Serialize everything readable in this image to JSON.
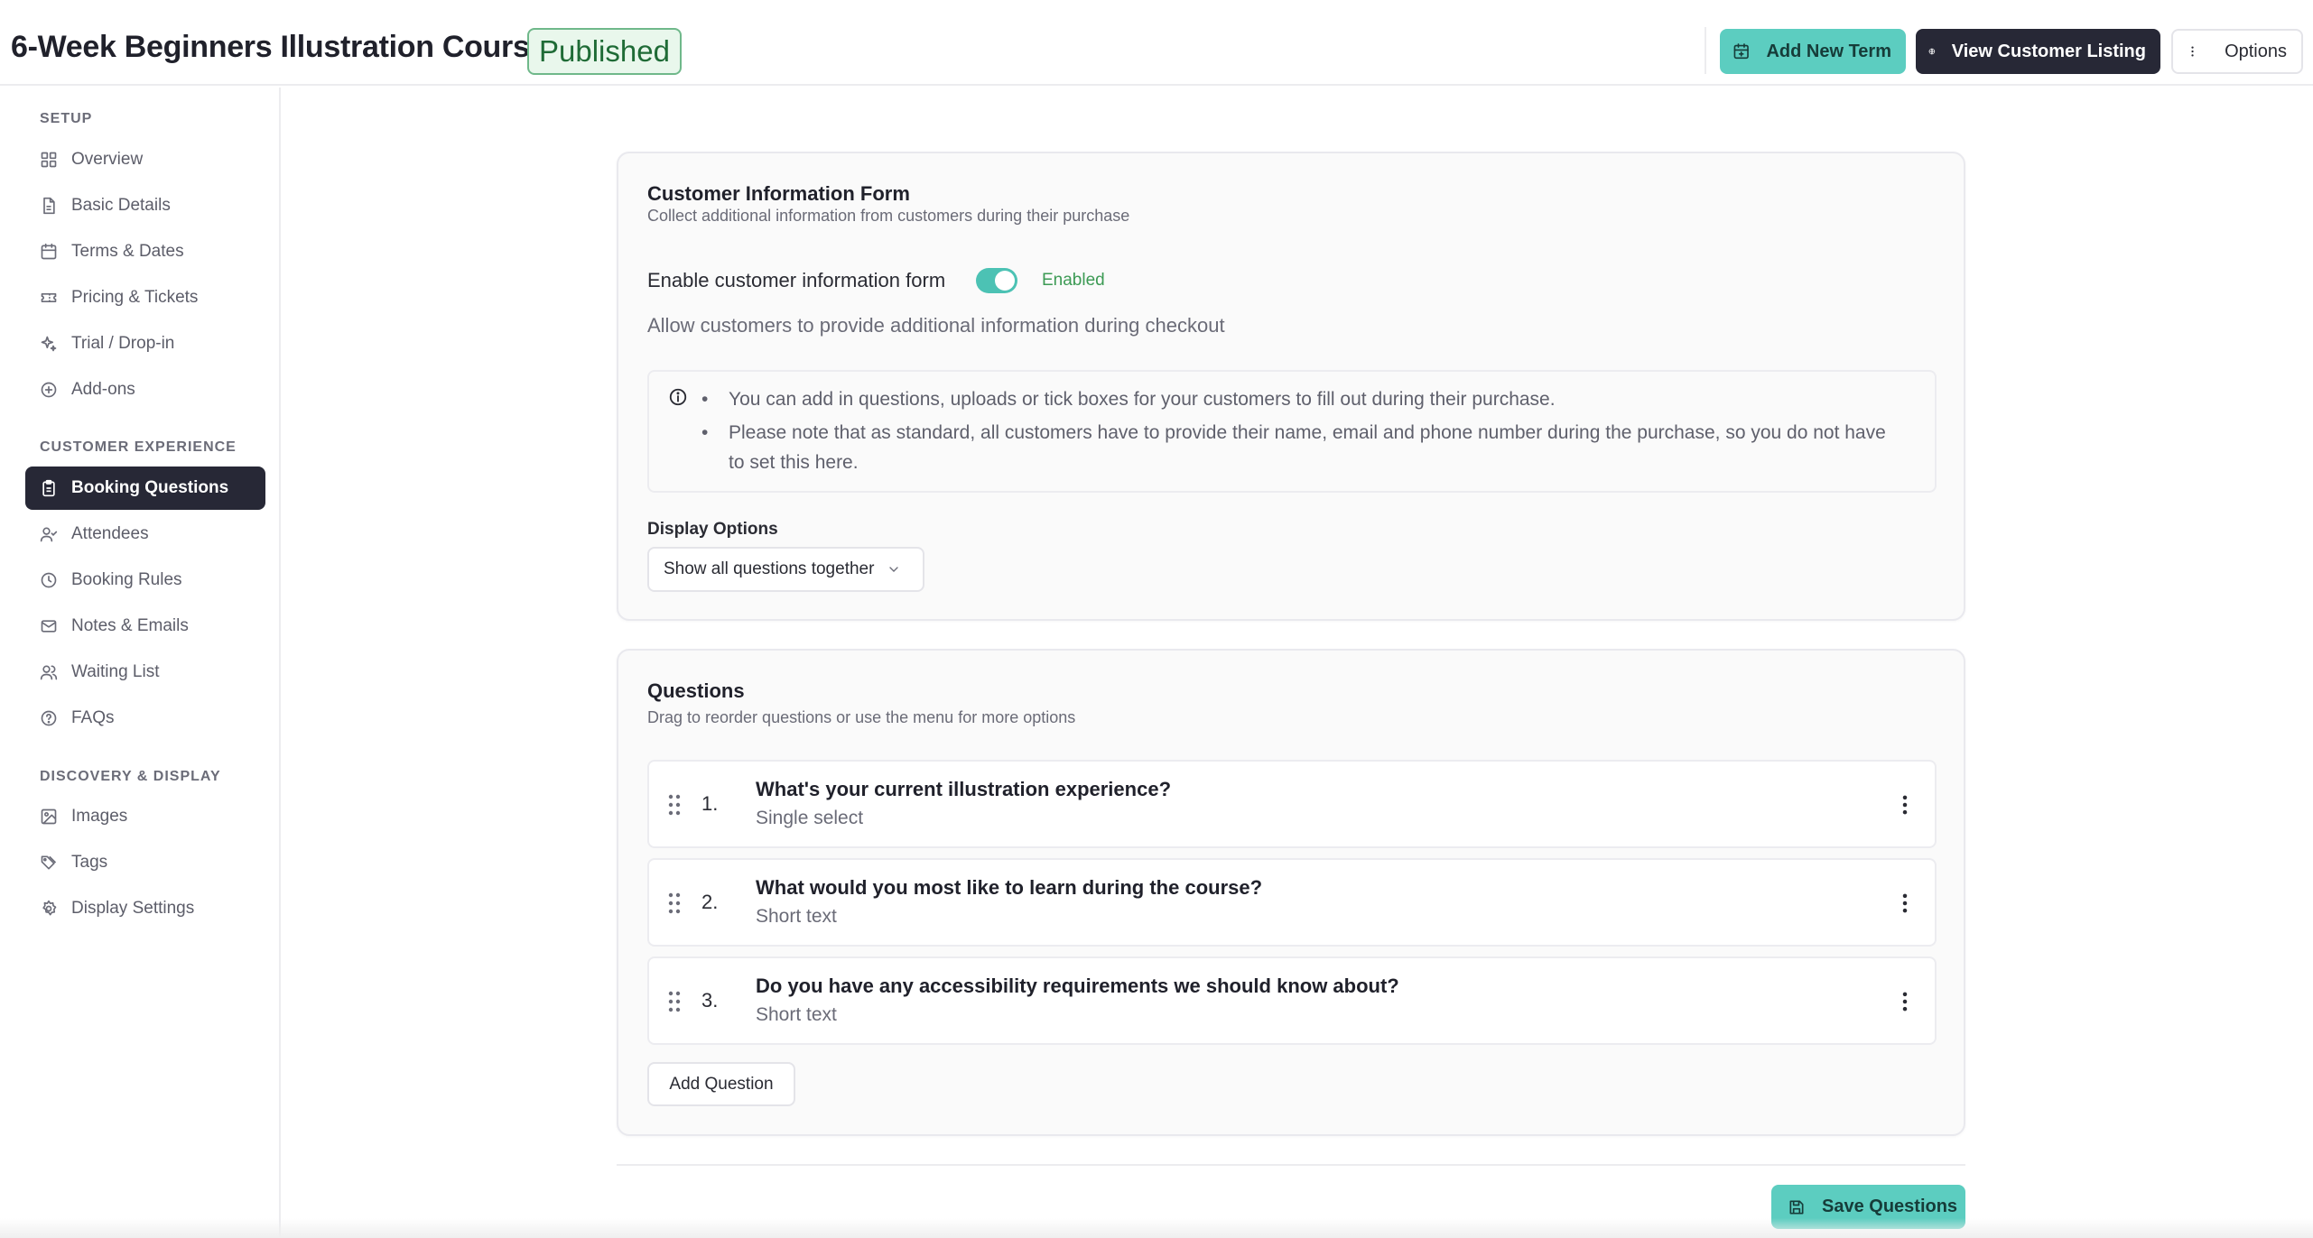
{
  "header": {
    "title": "6-Week Beginners Illustration Course",
    "status": "Published",
    "buttons": {
      "add_term": "Add New Term",
      "view_listing": "View Customer Listing",
      "options": "Options"
    }
  },
  "sidebar": {
    "sections": [
      {
        "title": "SETUP",
        "items": [
          {
            "label": "Overview",
            "icon": "grid-icon"
          },
          {
            "label": "Basic Details",
            "icon": "document-icon"
          },
          {
            "label": "Terms & Dates",
            "icon": "calendar-icon"
          },
          {
            "label": "Pricing & Tickets",
            "icon": "ticket-icon"
          },
          {
            "label": "Trial / Drop-in",
            "icon": "sparkle-icon"
          },
          {
            "label": "Add-ons",
            "icon": "plus-circle-icon"
          }
        ]
      },
      {
        "title": "CUSTOMER EXPERIENCE",
        "items": [
          {
            "label": "Booking Questions",
            "icon": "clipboard-icon",
            "active": true
          },
          {
            "label": "Attendees",
            "icon": "user-check-icon"
          },
          {
            "label": "Booking Rules",
            "icon": "clock-icon"
          },
          {
            "label": "Notes & Emails",
            "icon": "mail-icon"
          },
          {
            "label": "Waiting List",
            "icon": "users-icon"
          },
          {
            "label": "FAQs",
            "icon": "help-circle-icon"
          }
        ]
      },
      {
        "title": "DISCOVERY & DISPLAY",
        "items": [
          {
            "label": "Images",
            "icon": "image-icon"
          },
          {
            "label": "Tags",
            "icon": "tags-icon"
          },
          {
            "label": "Display Settings",
            "icon": "settings-icon"
          }
        ]
      }
    ]
  },
  "form_card": {
    "title": "Customer Information Form",
    "subtitle": "Collect additional information from customers during their purchase",
    "toggle_label": "Enable customer information form",
    "toggle_state": "Enabled",
    "toggle_on": true,
    "toggle_description": "Allow customers to provide additional information during checkout",
    "info": [
      "You can add in questions, uploads or tick boxes for your customers to fill out during their purchase.",
      "Please note that as standard, all customers have to provide their name, email and phone number during the purchase, so you do not have to set this here."
    ],
    "display_options_label": "Display Options",
    "display_options_value": "Show all questions together"
  },
  "questions_card": {
    "title": "Questions",
    "subtitle": "Drag to reorder questions or use the menu for more options",
    "questions": [
      {
        "number": "1.",
        "title": "What's your current illustration experience?",
        "type": "Single select"
      },
      {
        "number": "2.",
        "title": "What would you most like to learn during the course?",
        "type": "Short text"
      },
      {
        "number": "3.",
        "title": "Do you have any accessibility requirements we should know about?",
        "type": "Short text"
      }
    ],
    "add_label": "Add Question"
  },
  "footer": {
    "save_label": "Save Questions"
  },
  "colors": {
    "accent_teal": "#5ccdc0",
    "dark": "#272836",
    "published_green": "#1f6b36",
    "enabled_green": "#3c9a54"
  }
}
